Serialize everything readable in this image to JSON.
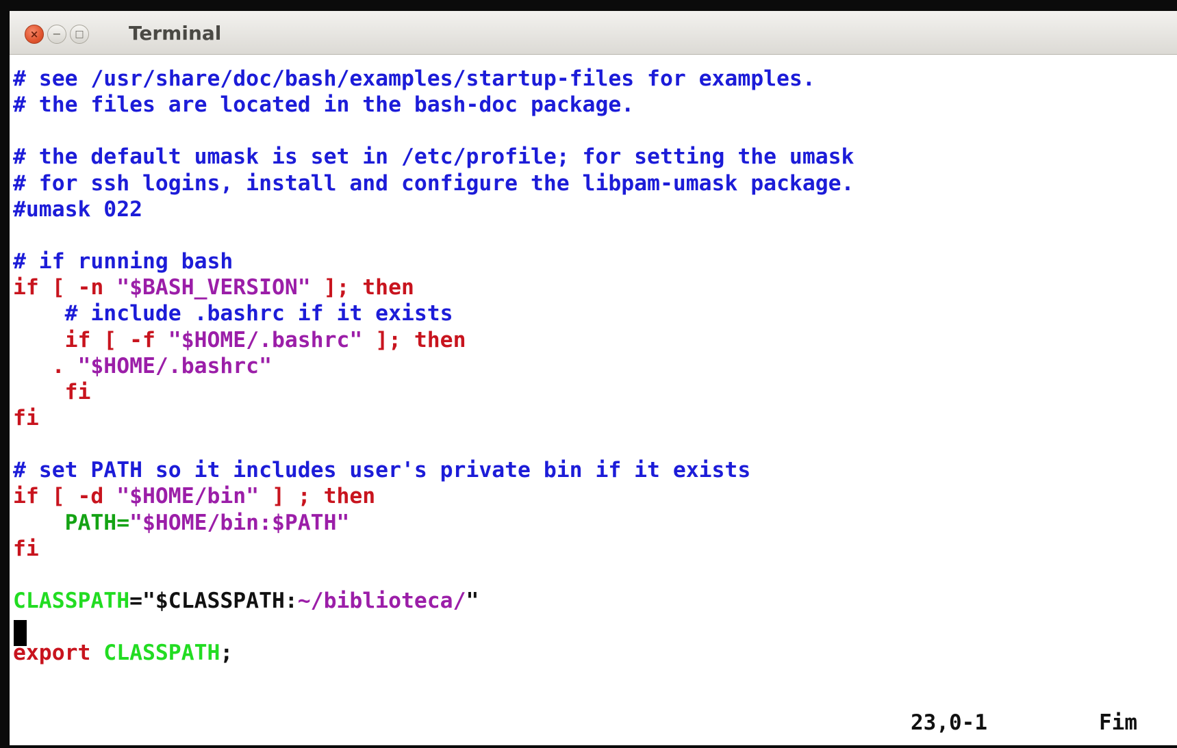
{
  "window": {
    "title": "Terminal",
    "close_glyph": "×",
    "minimize_glyph": "−",
    "maximize_glyph": "□"
  },
  "editor": {
    "lines": [
      [
        {
          "t": "# see /usr/share/doc/bash/examples/startup-files for examples.",
          "c": "comment"
        }
      ],
      [
        {
          "t": "# the files are located in the bash-doc package.",
          "c": "comment"
        }
      ],
      [],
      [
        {
          "t": "# the default umask is set in /etc/profile; for setting the umask",
          "c": "comment"
        }
      ],
      [
        {
          "t": "# for ssh logins, install and configure the libpam-umask package.",
          "c": "comment"
        }
      ],
      [
        {
          "t": "#umask 022",
          "c": "comment"
        }
      ],
      [],
      [
        {
          "t": "# if running bash",
          "c": "comment"
        }
      ],
      [
        {
          "t": "if [ -n ",
          "c": "red"
        },
        {
          "t": "\"$BASH_VERSION\"",
          "c": "purple"
        },
        {
          "t": " ]; then",
          "c": "red"
        }
      ],
      [
        {
          "t": "    # include .bashrc if it exists",
          "c": "comment"
        }
      ],
      [
        {
          "t": "    if [ -f ",
          "c": "red"
        },
        {
          "t": "\"$HOME/.bashrc\"",
          "c": "purple"
        },
        {
          "t": " ]; then",
          "c": "red"
        }
      ],
      [
        {
          "t": "   . ",
          "c": "red"
        },
        {
          "t": "\"$HOME/.bashrc\"",
          "c": "purple"
        }
      ],
      [
        {
          "t": "    fi",
          "c": "red"
        }
      ],
      [
        {
          "t": "fi",
          "c": "red"
        }
      ],
      [],
      [
        {
          "t": "# set PATH so it includes user's private bin if it exists",
          "c": "comment"
        }
      ],
      [
        {
          "t": "if [ -d ",
          "c": "red"
        },
        {
          "t": "\"$HOME/bin\"",
          "c": "purple"
        },
        {
          "t": " ] ; then",
          "c": "red"
        }
      ],
      [
        {
          "t": "    PATH=",
          "c": "green"
        },
        {
          "t": "\"$HOME/bin:$PATH\"",
          "c": "purple"
        }
      ],
      [
        {
          "t": "fi",
          "c": "red"
        }
      ],
      [],
      [
        {
          "t": "CLASSPATH",
          "c": "lime"
        },
        {
          "t": "=\"$CLASSPATH:",
          "c": "black"
        },
        {
          "t": "~/biblioteca/",
          "c": "purple"
        },
        {
          "t": "\"",
          "c": "black"
        }
      ],
      [],
      [
        {
          "t": "export ",
          "c": "red"
        },
        {
          "t": "CLASSPATH",
          "c": "lime"
        },
        {
          "t": ";",
          "c": "black"
        }
      ]
    ]
  },
  "statusbar": {
    "position": "23,0-1",
    "scroll": "Fim"
  },
  "colors": {
    "comment": "#1c1cd8",
    "keyword": "#c8141e",
    "string": "#9b1ea8",
    "identifier": "#14a314",
    "variable": "#22dc22",
    "titlebar": "#dcdad5",
    "close_button": "#e0552f"
  }
}
